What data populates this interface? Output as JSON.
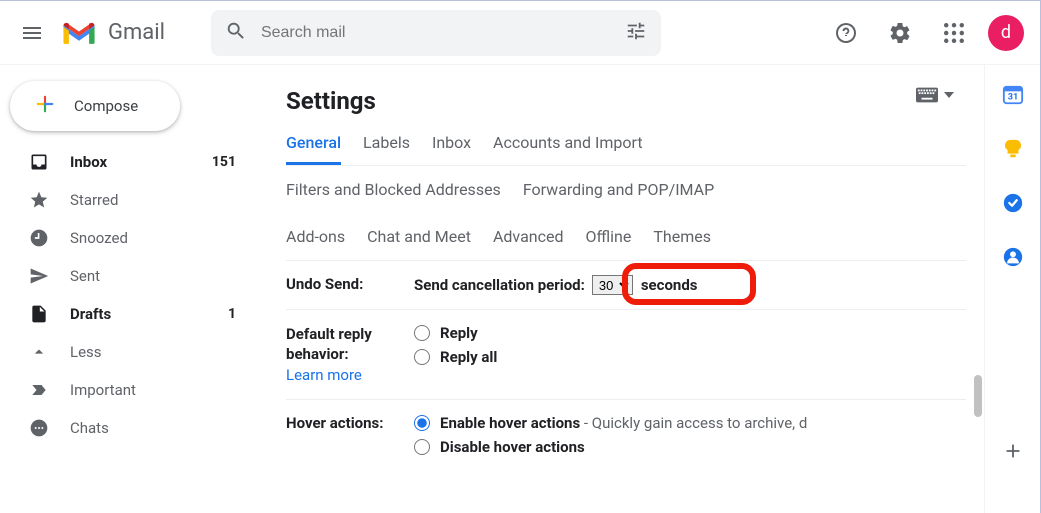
{
  "header": {
    "app_name": "Gmail",
    "search_placeholder": "Search mail",
    "avatar_letter": "d"
  },
  "compose": {
    "label": "Compose"
  },
  "sidebar": {
    "items": [
      {
        "label": "Inbox",
        "count": "151"
      },
      {
        "label": "Starred",
        "count": ""
      },
      {
        "label": "Snoozed",
        "count": ""
      },
      {
        "label": "Sent",
        "count": ""
      },
      {
        "label": "Drafts",
        "count": "1"
      },
      {
        "label": "Less",
        "count": ""
      },
      {
        "label": "Important",
        "count": ""
      },
      {
        "label": "Chats",
        "count": ""
      }
    ]
  },
  "settings": {
    "title": "Settings",
    "tabs": {
      "general": "General",
      "labels": "Labels",
      "inbox": "Inbox",
      "accounts": "Accounts and Import",
      "filters": "Filters and Blocked Addresses",
      "forwarding": "Forwarding and POP/IMAP",
      "addons": "Add-ons",
      "chat": "Chat and Meet",
      "advanced": "Advanced",
      "offline": "Offline",
      "themes": "Themes"
    },
    "undo_send": {
      "label": "Undo Send:",
      "period_label": "Send cancellation period:",
      "value": "30",
      "seconds_label": "seconds"
    },
    "default_reply": {
      "label": "Default reply behavior:",
      "learn_more": "Learn more",
      "reply": "Reply",
      "reply_all": "Reply all"
    },
    "hover": {
      "label": "Hover actions:",
      "enable": "Enable hover actions",
      "enable_desc": " - Quickly gain access to archive, d",
      "disable": "Disable hover actions"
    }
  }
}
